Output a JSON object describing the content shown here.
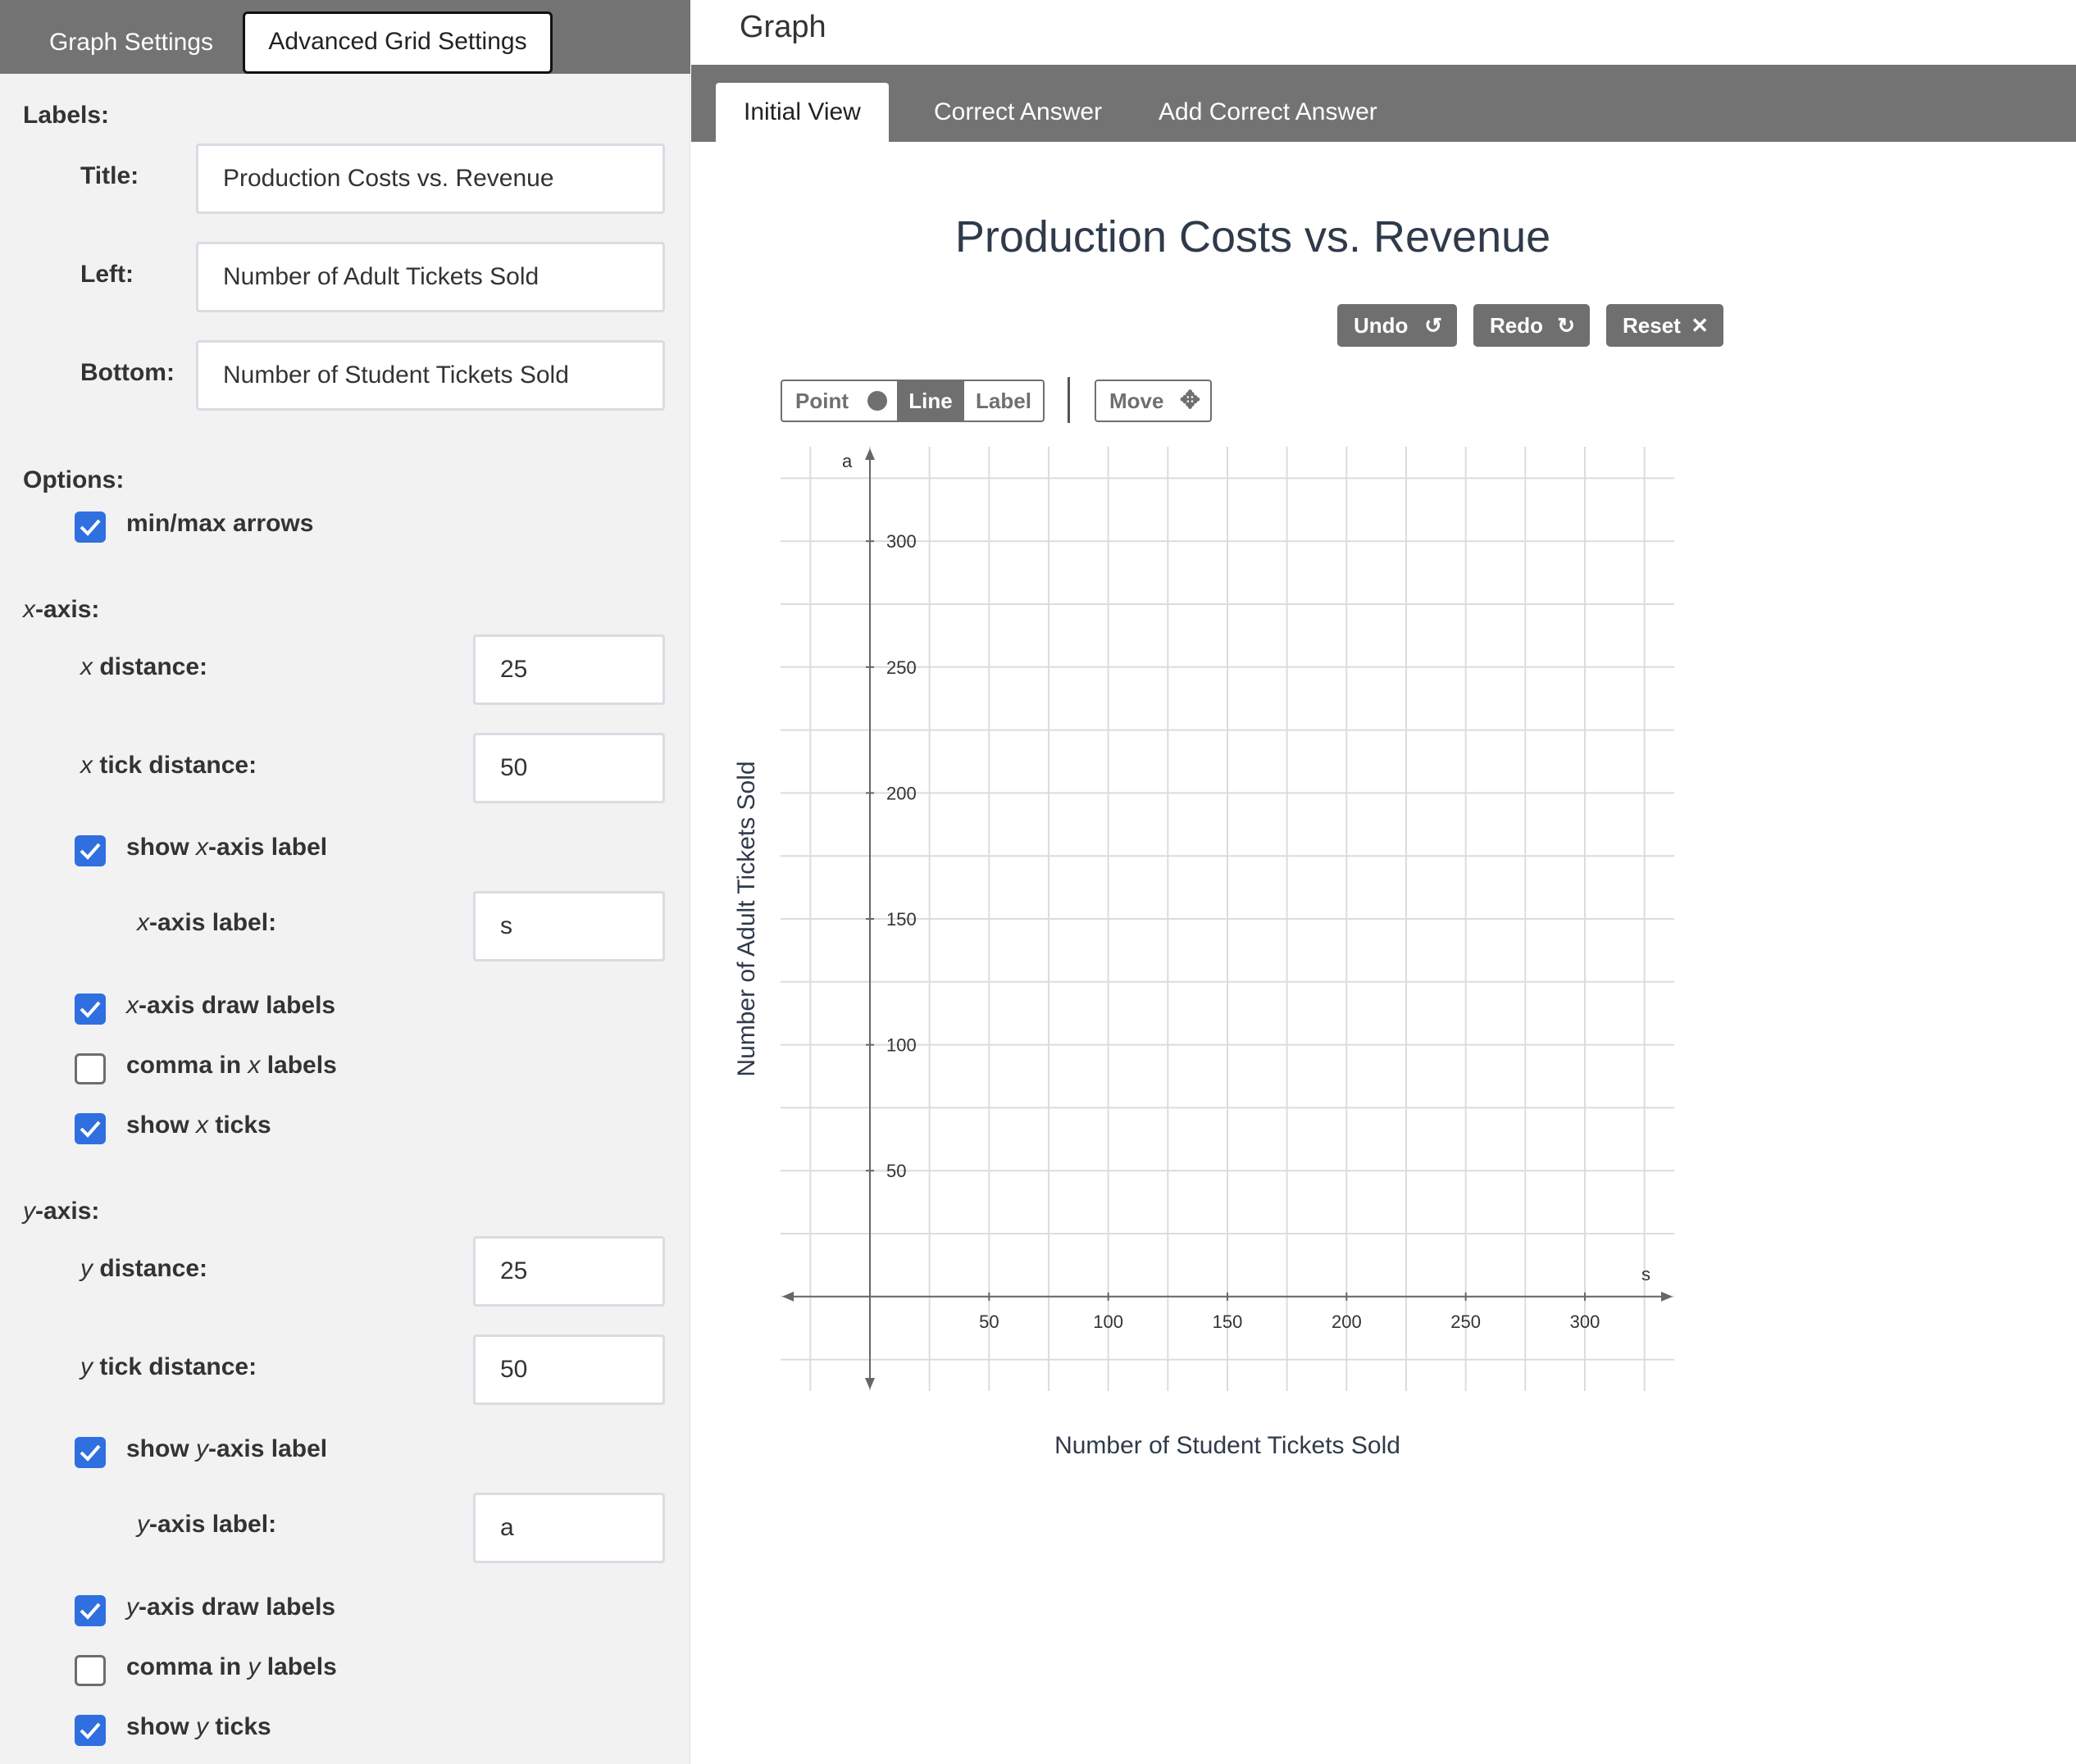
{
  "left_tabs": {
    "graph_settings": "Graph Settings",
    "advanced": "Advanced Grid Settings"
  },
  "labels": {
    "heading": "Labels:",
    "title_label": "Title:",
    "title_value": "Production Costs vs. Revenue",
    "left_label": "Left:",
    "left_value": "Number of Adult Tickets Sold",
    "bottom_label": "Bottom:",
    "bottom_value": "Number of Student Tickets Sold"
  },
  "options": {
    "heading": "Options:",
    "minmax_label": "min/max arrows",
    "minmax_checked": true
  },
  "x_axis": {
    "distance_value": "25",
    "tick_distance_value": "50",
    "show_label_checked": true,
    "label_value": "s",
    "draw_labels_checked": true,
    "comma_checked": false,
    "show_ticks_checked": true
  },
  "y_axis": {
    "distance_value": "25",
    "tick_distance_value": "50",
    "show_label_checked": true,
    "label_value": "a",
    "draw_labels_checked": true,
    "comma_checked": false,
    "show_ticks_checked": true
  },
  "graph_panel": {
    "title": "Graph",
    "tabs": [
      "Initial View",
      "Correct Answer",
      "Add Correct Answer"
    ],
    "active_tab": "Initial View"
  },
  "actions": {
    "undo": "Undo",
    "redo": "Redo",
    "reset": "Reset"
  },
  "tools": {
    "point": "Point",
    "line": "Line",
    "label": "Label",
    "move": "Move",
    "selected": "Line"
  },
  "icons": {
    "undo": "undo-icon",
    "redo": "redo-icon",
    "reset": "close-icon",
    "point": "circle-icon",
    "move": "move-arrows-icon",
    "check": "checkmark-icon"
  },
  "colors": {
    "checkbox": "#2f6fe0",
    "tabbar": "#737373",
    "button": "#6f6f6f"
  },
  "chart_data": {
    "type": "scatter",
    "title": "Production Costs vs. Revenue",
    "xlabel": "Number of Student Tickets Sold",
    "ylabel": "Number of Adult Tickets Sold",
    "x_axis_letter": "s",
    "y_axis_letter": "a",
    "xlim": [
      -37.5,
      337.5
    ],
    "ylim": [
      -37.5,
      337.5
    ],
    "grid_step": 25,
    "x_ticks": [
      50,
      100,
      150,
      200,
      250,
      300
    ],
    "y_ticks": [
      50,
      100,
      150,
      200,
      250,
      300
    ],
    "grid": true,
    "series": []
  }
}
